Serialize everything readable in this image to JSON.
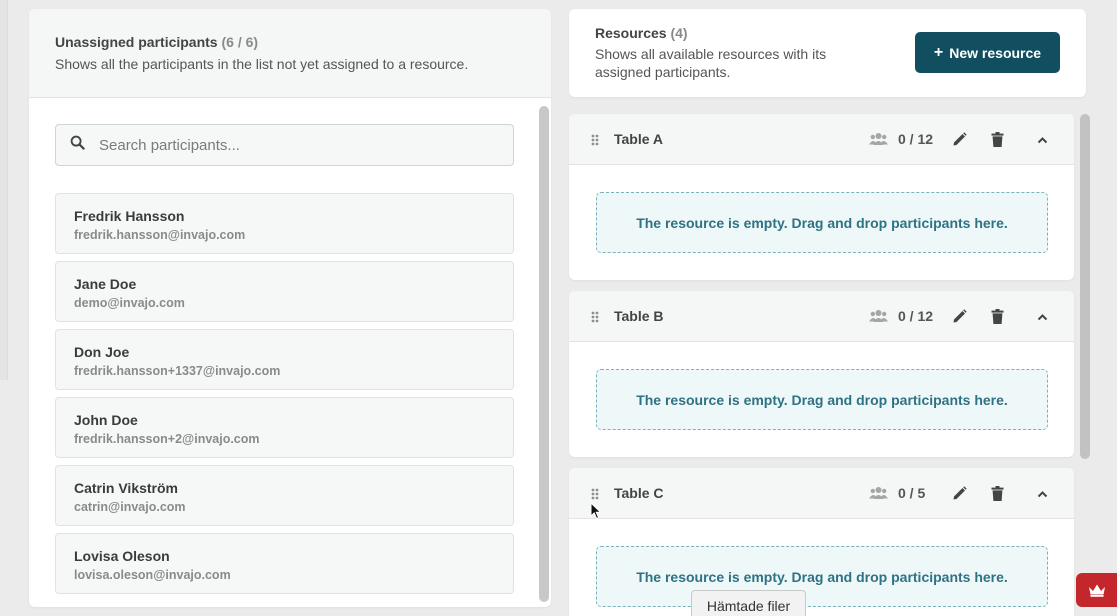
{
  "unassigned": {
    "title": "Unassigned participants",
    "count": "(6 / 6)",
    "description": "Shows all the participants in the list not yet assigned to a resource.",
    "search_placeholder": "Search participants...",
    "participants": [
      {
        "name": "Fredrik Hansson",
        "email": "fredrik.hansson@invajo.com"
      },
      {
        "name": "Jane Doe",
        "email": "demo@invajo.com"
      },
      {
        "name": "Don Joe",
        "email": "fredrik.hansson+1337@invajo.com"
      },
      {
        "name": "John Doe",
        "email": "fredrik.hansson+2@invajo.com"
      },
      {
        "name": "Catrin Vikström",
        "email": "catrin@invajo.com"
      },
      {
        "name": "Lovisa Oleson",
        "email": "lovisa.oleson@invajo.com"
      }
    ]
  },
  "resources": {
    "title": "Resources",
    "count": "(4)",
    "description": "Shows all available resources with its assigned participants.",
    "new_button_label": "New resource",
    "items": [
      {
        "name": "Table A",
        "capacity": "0 / 12",
        "empty_text": "The resource is empty. Drag and drop participants here."
      },
      {
        "name": "Table B",
        "capacity": "0 / 12",
        "empty_text": "The resource is empty. Drag and drop participants here."
      },
      {
        "name": "Table C",
        "capacity": "0 / 5",
        "empty_text": "The resource is empty. Drag and drop participants here."
      }
    ]
  },
  "downloads_tooltip": "Hämtade filer",
  "colors": {
    "primary": "#114f60",
    "dropzone_text": "#2f7284",
    "badge": "#c3272b"
  },
  "icons": [
    "search-icon",
    "drag-handle-icon",
    "people-icon",
    "edit-icon",
    "trash-icon",
    "chevron-up-icon",
    "crown-icon",
    "plus-icon"
  ]
}
